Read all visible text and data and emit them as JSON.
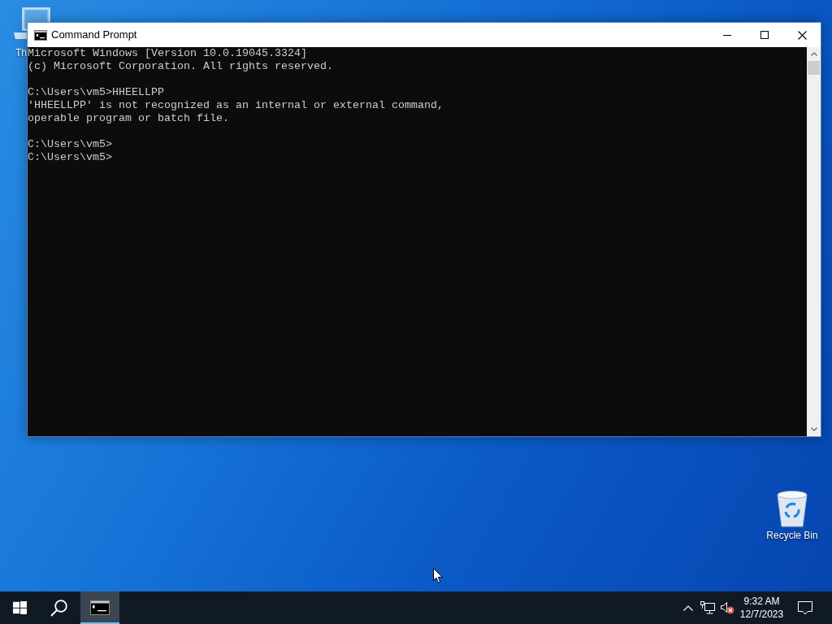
{
  "desktop": {
    "icons": [
      {
        "kind": "computer",
        "label": "Th"
      },
      {
        "kind": "recycle-bin",
        "label": "Recycle Bin"
      }
    ]
  },
  "window": {
    "title": "Command Prompt",
    "console": {
      "blocks": [
        [
          "Microsoft Windows [Version 10.0.19045.3324]",
          "(c) Microsoft Corporation. All rights reserved."
        ],
        [
          "C:\\Users\\vm5>HHEELLPP",
          "'HHEELLPP' is not recognized as an internal or external command,",
          "operable program or batch file."
        ],
        [
          "C:\\Users\\vm5>",
          "C:\\Users\\vm5>"
        ]
      ]
    }
  },
  "taskbar": {
    "buttons": [
      {
        "kind": "start",
        "selected": false
      },
      {
        "kind": "search",
        "selected": false
      },
      {
        "kind": "terminal",
        "selected": true
      }
    ],
    "tray": {
      "volume_muted": true,
      "time": "9:32 AM",
      "date": "12/7/2023"
    }
  }
}
